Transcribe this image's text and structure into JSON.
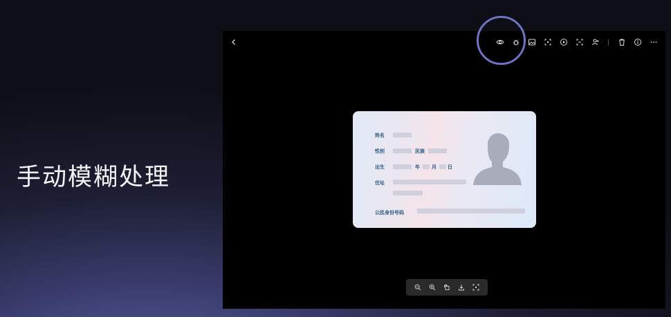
{
  "caption": "手动模糊处理",
  "viewer": {
    "toolbar_icons": [
      "eye-icon",
      "bug-icon",
      "image-icon",
      "scan-icon",
      "play-circle-icon",
      "screenshot-icon",
      "user-mosaic-icon",
      "trash-icon",
      "info-icon",
      "more-icon"
    ],
    "zoom_icons": [
      "zoom-out-icon",
      "zoom-in-icon",
      "rotate-icon",
      "download-icon",
      "fullscreen-icon"
    ]
  },
  "id_card": {
    "name_label": "姓名",
    "gender_label": "性别",
    "ethnicity_label": "民族",
    "birth_label": "出生",
    "year_label": "年",
    "month_label": "月",
    "day_label": "日",
    "address_label": "住址",
    "id_number_label": "公民身份号码"
  },
  "colors": {
    "highlight_ring": "#6f73c2",
    "label_blue": "#2f5d88"
  }
}
